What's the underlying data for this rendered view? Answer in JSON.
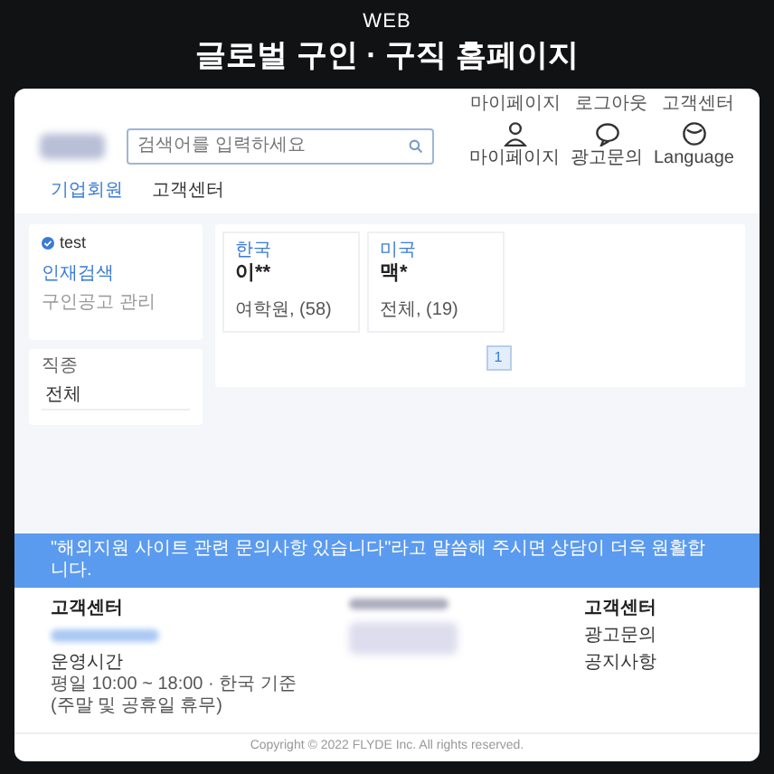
{
  "hero": {
    "eyebrow": "WEB",
    "title": "글로벌 구인 · 구직 홈페이지"
  },
  "top_links": [
    "마이페이지",
    "로그아웃",
    "고객센터"
  ],
  "search": {
    "placeholder": "검색어를 입력하세요"
  },
  "header_icons": [
    {
      "kind": "user",
      "label": "마이페이지"
    },
    {
      "kind": "chat",
      "label": "광고문의"
    },
    {
      "kind": "globe",
      "label": "Language"
    }
  ],
  "nav": [
    {
      "label": "기업회원",
      "selected": true
    },
    {
      "label": "고객센터",
      "selected": false
    }
  ],
  "sidebar": {
    "user": "test",
    "items": [
      {
        "label": "인재검색",
        "selected": true
      },
      {
        "label": "구인공고 관리",
        "selected": false
      }
    ],
    "filter_label": "직종",
    "filter_value": "전체"
  },
  "cards": [
    {
      "country": "한국",
      "name": "이**",
      "detail": "여학원, (58)"
    },
    {
      "country": "미국",
      "name": "맥*",
      "detail": "전체, (19)"
    }
  ],
  "pagination": [
    {
      "label": "1",
      "selected": true
    }
  ],
  "banner": "\"해외지원 사이트 관련 문의사항 있습니다\"라고 말씀해 주시면 상담이 더욱 원활합니다.",
  "footer": {
    "left_title": "고객센터",
    "hours_title": "운영시간",
    "hours": [
      "평일 10:00 ~ 18:00 · 한국 기준",
      "(주말 및 공휴일 휴무)"
    ],
    "right_title": "고객센터",
    "right_links": [
      "광고문의",
      "공지사항"
    ],
    "copyright": "Copyright © 2022 FLYDE Inc. All rights reserved."
  }
}
